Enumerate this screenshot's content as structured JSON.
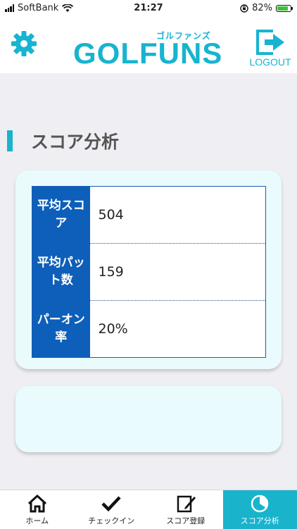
{
  "status_bar": {
    "carrier": "SoftBank",
    "time": "21:27",
    "battery": "82%"
  },
  "header": {
    "logo_main": "GOLFUNS",
    "logo_sub": "ゴルファンズ",
    "logout_label": "LOGOUT"
  },
  "page": {
    "title": "スコア分析"
  },
  "stats": {
    "rows": [
      {
        "label": "平均スコア",
        "value": "504"
      },
      {
        "label": "平均パット数",
        "value": "159"
      },
      {
        "label": "パーオン率",
        "value": "20%"
      }
    ]
  },
  "tabs": [
    {
      "label": "ホーム",
      "icon": "home-icon",
      "active": false
    },
    {
      "label": "チェックイン",
      "icon": "check-icon",
      "active": false
    },
    {
      "label": "スコア登録",
      "icon": "edit-icon",
      "active": false
    },
    {
      "label": "スコア分析",
      "icon": "pie-chart-icon",
      "active": true
    }
  ],
  "colors": {
    "accent": "#19b3cc",
    "table_header": "#0d5fba",
    "card_bg": "#e9fbfd"
  }
}
